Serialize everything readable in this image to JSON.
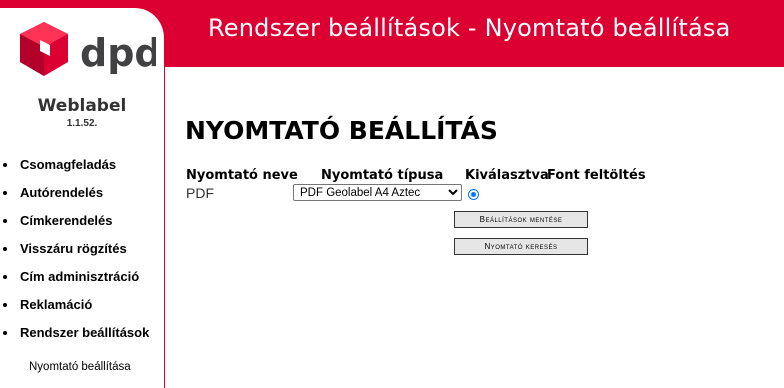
{
  "header": {
    "title": "Rendszer beállítások - Nyomtató beállítása"
  },
  "brand": {
    "logo_text": "dpd",
    "name": "Weblabel",
    "version": "1.1.52."
  },
  "sidebar": {
    "items": [
      {
        "label": "Csomagfeladás"
      },
      {
        "label": "Autórendelés"
      },
      {
        "label": "Címkerendelés"
      },
      {
        "label": "Visszáru rögzítés"
      },
      {
        "label": "Cím adminisztráció"
      },
      {
        "label": "Reklamáció"
      },
      {
        "label": "Rendszer beállítások"
      }
    ],
    "sub_item": "Nyomtató beállítása"
  },
  "main": {
    "title": "NYOMTATÓ BEÁLLÍTÁS",
    "columns": {
      "name": "Nyomtató neve",
      "type": "Nyomtató típusa",
      "selected": "Kiválasztva",
      "font_upload": "Font feltöltés"
    },
    "rows": [
      {
        "name": "PDF",
        "type": "PDF Geolabel A4 Aztec",
        "selected": true
      }
    ],
    "buttons": {
      "save": "Beállítások mentése",
      "search": "Nyomtató keresés"
    }
  },
  "colors": {
    "brand_red": "#dc0032",
    "radio_blue": "#0075ff"
  }
}
